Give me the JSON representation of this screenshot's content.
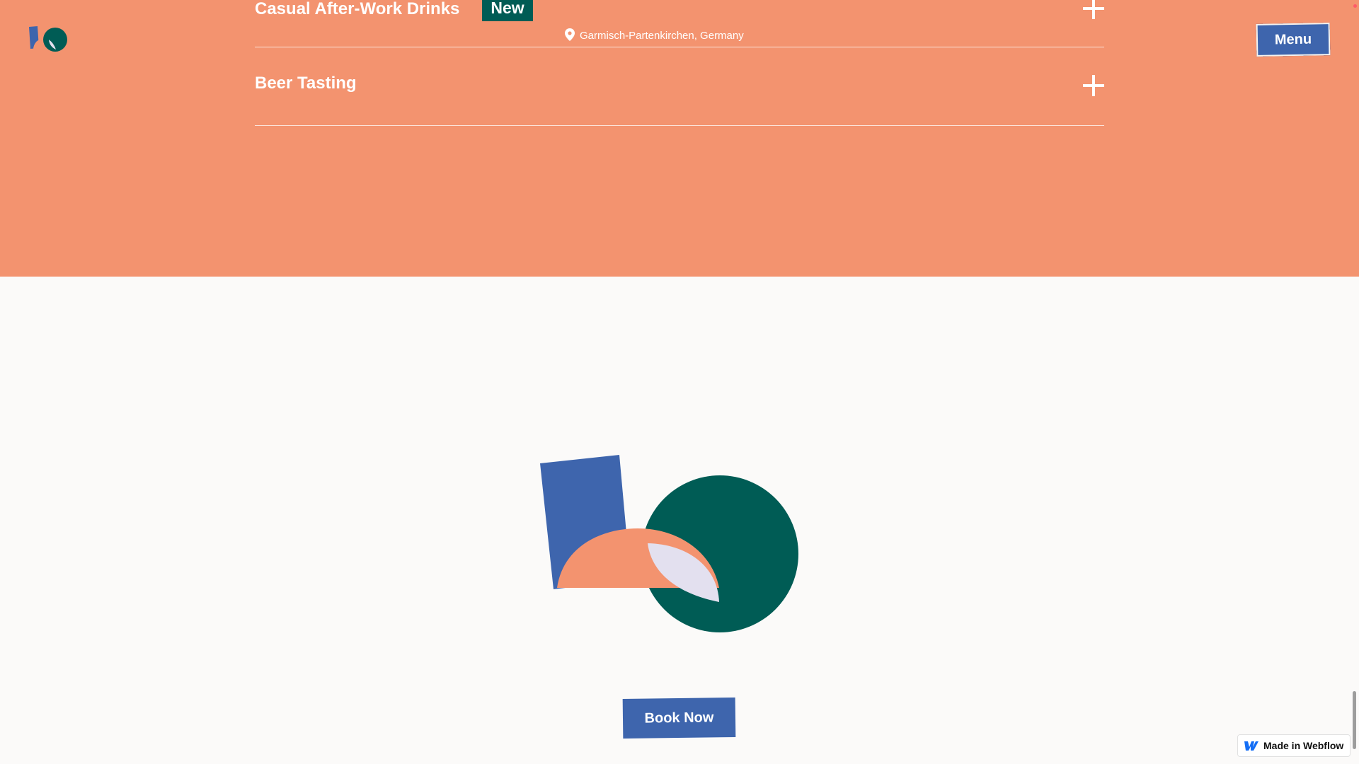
{
  "header": {
    "menu_label": "Menu"
  },
  "events": [
    {
      "title": "Casual After-Work Drinks",
      "tag": "New",
      "location": "Garmisch-Partenkirchen, Germany"
    },
    {
      "title": "Beer Tasting"
    }
  ],
  "cta": {
    "book_label": "Book Now"
  },
  "badge": {
    "label": "Made in Webflow"
  },
  "colors": {
    "hero": "#f3936f",
    "blue": "#3e65ad",
    "green": "#005c55",
    "lavender": "#e3e0ef"
  },
  "icons": {
    "location": "map-pin-icon",
    "expand": "plus-icon",
    "brand": "webflow-logo-icon"
  }
}
